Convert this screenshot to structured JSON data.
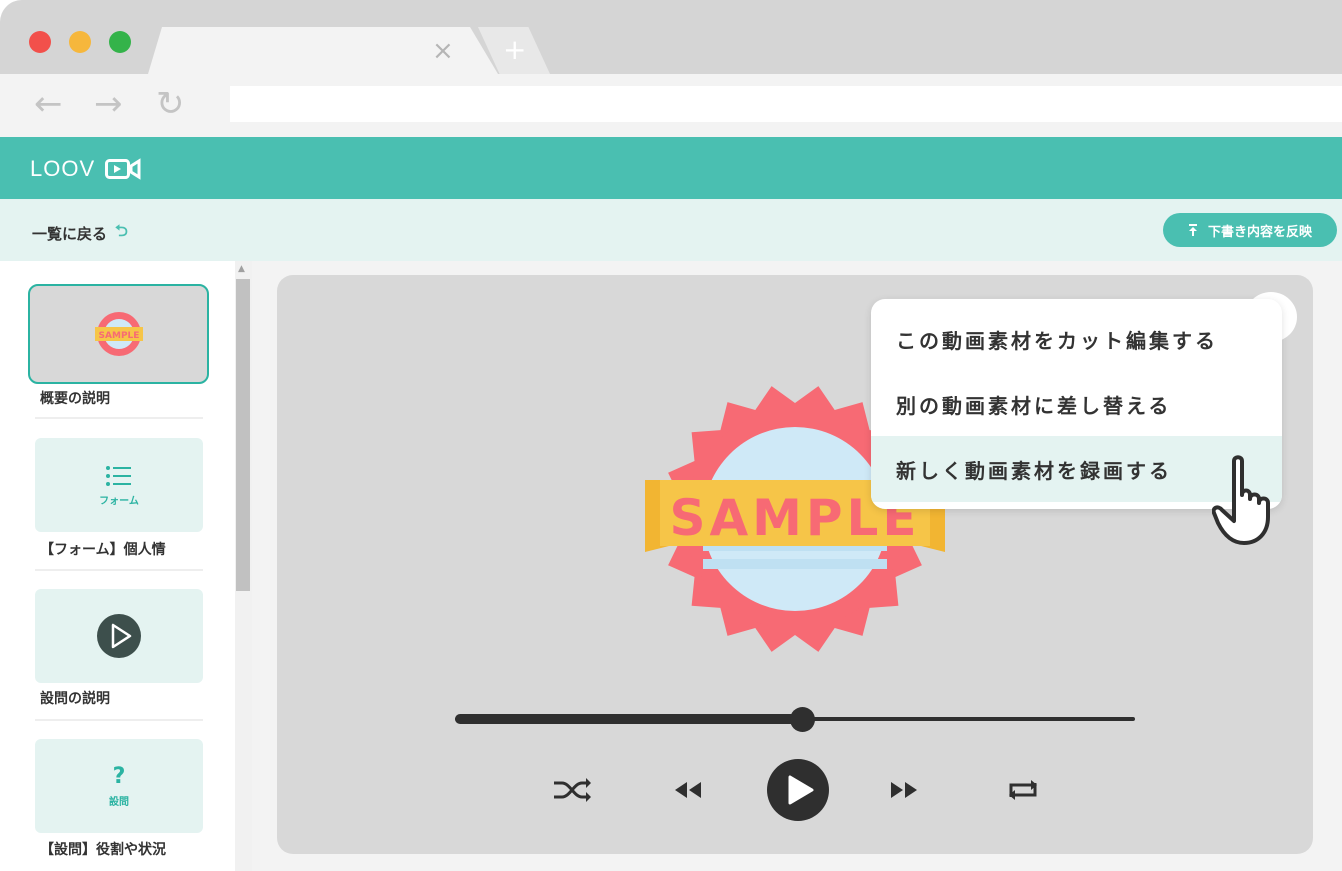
{
  "browser": {
    "tab_close": "×",
    "tab_new": "+",
    "nav_back": "←",
    "nav_forward": "→",
    "nav_reload": "↻"
  },
  "app": {
    "logo_text": "LOOV",
    "accent_color": "#4abfb1"
  },
  "subbar": {
    "back_label": "一覧に戻る",
    "back_icon": "undo-icon",
    "reflect_label": "下書き内容を反映",
    "reflect_icon": "upload-icon"
  },
  "sidebar": {
    "items": [
      {
        "label": "概要の説明",
        "thumb": "sample-badge",
        "selected": true
      },
      {
        "label": "【フォーム】個人情",
        "thumb": "list-icon",
        "sub": "フォーム"
      },
      {
        "label": "設問の説明",
        "thumb": "play-circle-icon"
      },
      {
        "label": "【設問】役割や状況",
        "thumb": "question-icon",
        "sub": "設問",
        "glyph": "?"
      }
    ]
  },
  "player": {
    "sample_text": "SAMPLE",
    "progress": 0.51,
    "controls": [
      "shuffle-icon",
      "rewind-icon",
      "play-icon",
      "fast-forward-icon",
      "repeat-icon"
    ]
  },
  "menu": {
    "items": [
      {
        "label": "この動画素材をカット編集する"
      },
      {
        "label": "別の動画素材に差し替える"
      },
      {
        "label": "新しく動画素材を録画する",
        "hover": true
      }
    ]
  }
}
